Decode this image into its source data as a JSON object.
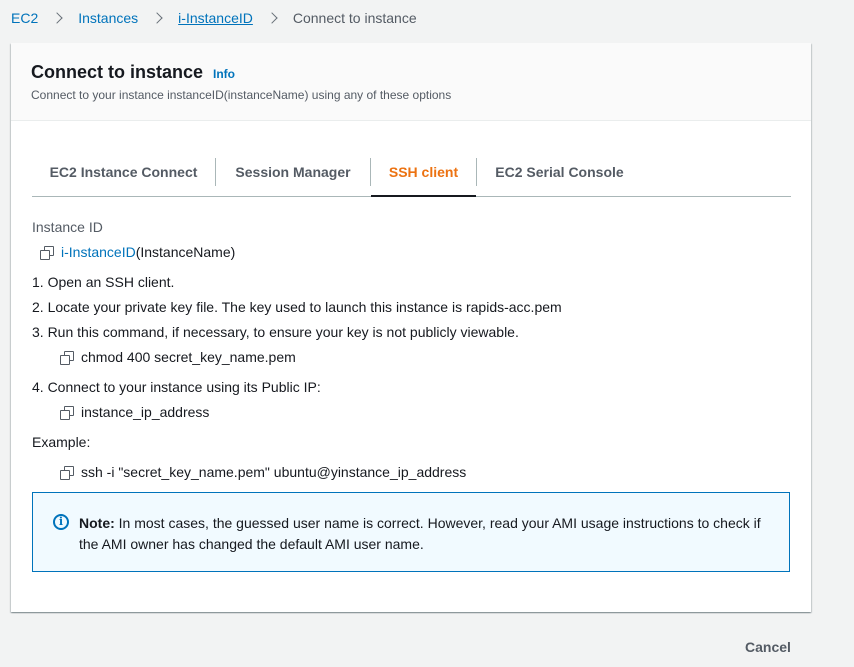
{
  "breadcrumb": {
    "items": [
      "EC2",
      "Instances",
      "i-InstanceID"
    ],
    "current": "Connect to instance"
  },
  "header": {
    "title": "Connect to instance",
    "info": "Info",
    "subtitle": "Connect to your instance instanceID(instanceName) using any of these options"
  },
  "tabs": [
    {
      "label": "EC2 Instance Connect",
      "active": false
    },
    {
      "label": "Session Manager",
      "active": false
    },
    {
      "label": "SSH client",
      "active": true
    },
    {
      "label": "EC2 Serial Console",
      "active": false
    }
  ],
  "content": {
    "instance_label": "Instance ID",
    "instance_id": "i-InstanceID",
    "instance_name": "(InstanceName)",
    "steps": [
      "1. Open an SSH client.",
      "2. Locate your private key file. The key used to launch this instance is rapids-acc.pem",
      "3. Run this command, if necessary, to ensure your key is not publicly viewable.",
      "4. Connect to your instance using its Public IP:"
    ],
    "chmod_command": "chmod 400 secret_key_name.pem",
    "ip_value": "instance_ip_address",
    "example_label": "Example:",
    "ssh_command": "ssh -i \"secret_key_name.pem\" ubuntu@yinstance_ip_address"
  },
  "alert": {
    "icon": "info-circle-icon",
    "note_label": "Note:",
    "text": " In most cases, the guessed user name is correct. However, read your AMI usage instructions to check if the AMI owner has changed the default AMI user name."
  },
  "footer": {
    "cancel_label": "Cancel"
  },
  "colors": {
    "link": "#0073bb",
    "active_tab": "#ec7211",
    "alert_bg": "#f1faff",
    "alert_border": "#0073bb"
  }
}
